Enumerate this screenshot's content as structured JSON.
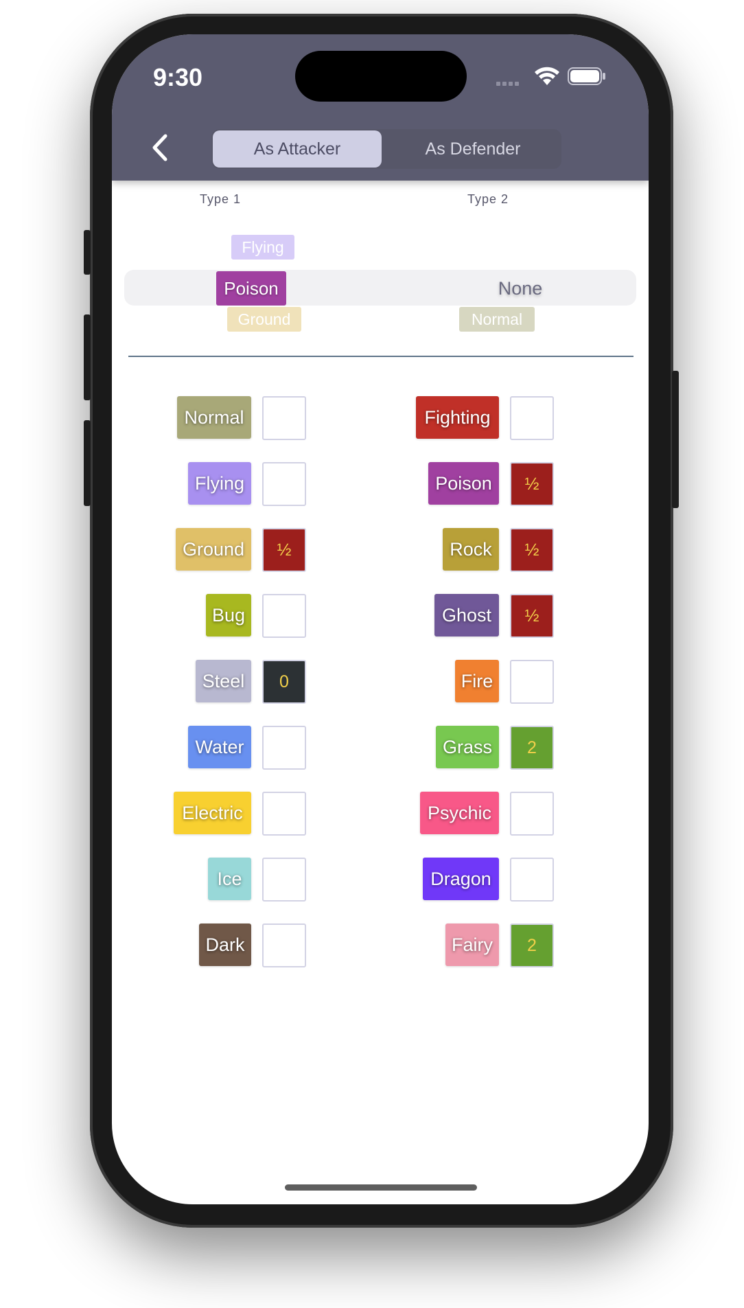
{
  "status_bar": {
    "time": "9:30"
  },
  "nav": {
    "back_icon": "chevron-left-icon",
    "tabs": [
      {
        "label": "As Attacker",
        "active": true
      },
      {
        "label": "As Defender",
        "active": false
      }
    ]
  },
  "picker": {
    "type1_label": "Type 1",
    "type2_label": "Type 2",
    "type1_above": "Flying",
    "type1_selected": "Poison",
    "type1_below": "Ground",
    "type2_selected": "None",
    "type2_below": "Normal"
  },
  "matchups": {
    "left": [
      {
        "type": "Normal",
        "color": "#a8a878",
        "multiplier": ""
      },
      {
        "type": "Flying",
        "color": "#a890f0",
        "multiplier": ""
      },
      {
        "type": "Ground",
        "color": "#e0c068",
        "multiplier": "½"
      },
      {
        "type": "Bug",
        "color": "#a8b820",
        "multiplier": ""
      },
      {
        "type": "Steel",
        "color": "#b8b8d0",
        "multiplier": "0"
      },
      {
        "type": "Water",
        "color": "#6890f0",
        "multiplier": ""
      },
      {
        "type": "Electric",
        "color": "#f8d030",
        "multiplier": ""
      },
      {
        "type": "Ice",
        "color": "#98d8d8",
        "multiplier": ""
      },
      {
        "type": "Dark",
        "color": "#705848",
        "multiplier": ""
      }
    ],
    "right": [
      {
        "type": "Fighting",
        "color": "#c03028",
        "multiplier": ""
      },
      {
        "type": "Poison",
        "color": "#a040a0",
        "multiplier": "½"
      },
      {
        "type": "Rock",
        "color": "#b8a038",
        "multiplier": "½"
      },
      {
        "type": "Ghost",
        "color": "#705898",
        "multiplier": "½"
      },
      {
        "type": "Fire",
        "color": "#f08030",
        "multiplier": ""
      },
      {
        "type": "Grass",
        "color": "#78c850",
        "multiplier": "2"
      },
      {
        "type": "Psychic",
        "color": "#f85888",
        "multiplier": ""
      },
      {
        "type": "Dragon",
        "color": "#7038f8",
        "multiplier": ""
      },
      {
        "type": "Fairy",
        "color": "#ee99ac",
        "multiplier": "2"
      }
    ]
  }
}
